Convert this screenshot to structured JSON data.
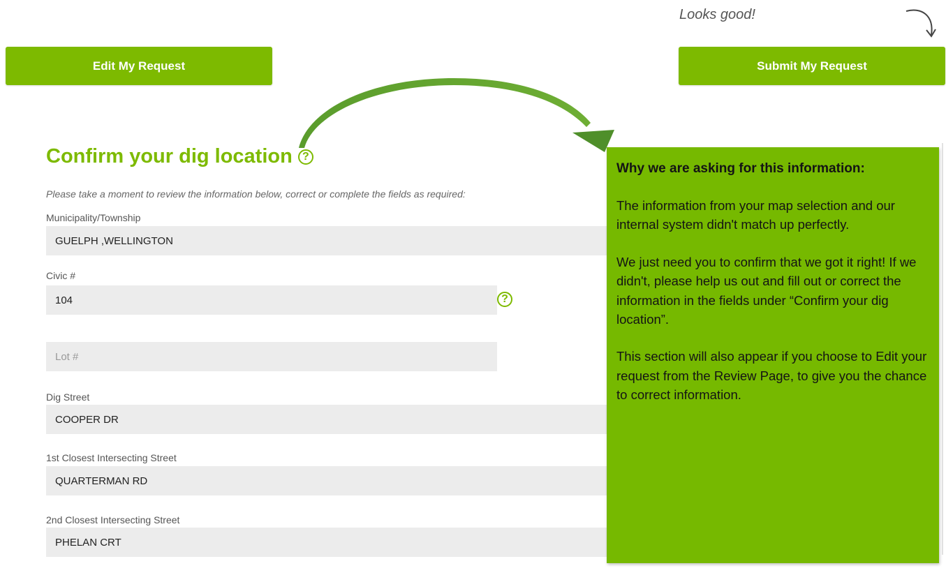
{
  "header": {
    "looks_good": "Looks good!",
    "edit_label": "Edit My Request",
    "submit_label": "Submit My Request"
  },
  "section": {
    "title": "Confirm your dig location",
    "help_symbol": "?",
    "intro": "Please take a moment to review the information below, correct or complete the fields as required:"
  },
  "fields": {
    "municipality": {
      "label": "Municipality/Township",
      "value": "GUELPH ,WELLINGTON"
    },
    "civic": {
      "label": "Civic #",
      "value": "104"
    },
    "lot": {
      "placeholder": "Lot #"
    },
    "dig_street": {
      "label": "Dig Street",
      "value": "COOPER DR"
    },
    "intersect1": {
      "label": "1st Closest Intersecting Street",
      "value": "QUARTERMAN RD"
    },
    "intersect2": {
      "label": "2nd Closest Intersecting Street",
      "value": "PHELAN CRT"
    }
  },
  "tooltip": {
    "heading": "Why we are asking for this information:",
    "p1": "The information from your map selection and our internal system didn't match up perfectly.",
    "p2": "We just need you to confirm that we got it right! If we didn't, please help us out and fill out or correct the information in the fields under “Confirm your dig location”.",
    "p3": "This section will also appear if you choose to Edit your request from the Review Page, to give you the chance to correct information."
  },
  "colors": {
    "accent": "#7dba00",
    "tooltip_bg": "#76b900",
    "field_bg": "#ececec"
  }
}
